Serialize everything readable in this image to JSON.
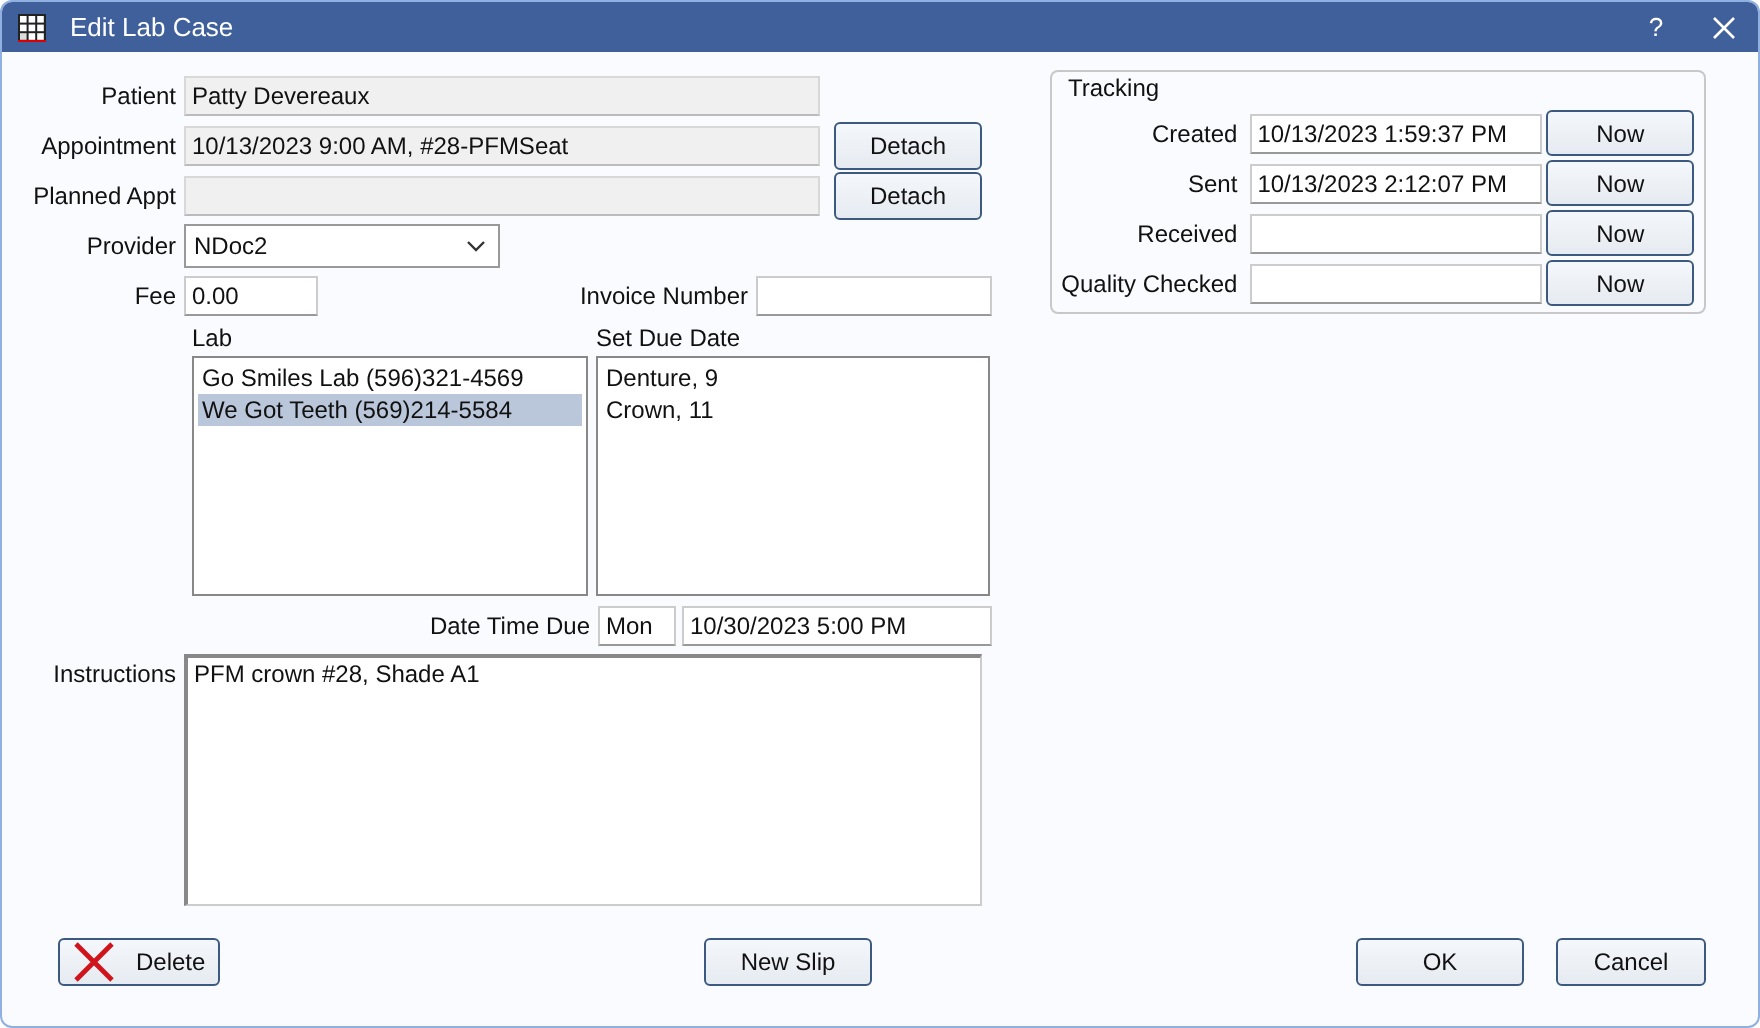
{
  "window": {
    "title": "Edit Lab Case",
    "help": "?"
  },
  "patient": {
    "label": "Patient",
    "value": "Patty Devereaux"
  },
  "appointment": {
    "label": "Appointment",
    "value": "10/13/2023 9:00 AM, #28-PFMSeat",
    "button": "Detach"
  },
  "planned_appt": {
    "label": "Planned Appt",
    "button": "Detach"
  },
  "provider": {
    "label": "Provider",
    "value": "NDoc2"
  },
  "fee": {
    "label": "Fee",
    "value": "0.00"
  },
  "invoice_number": {
    "label": "Invoice Number"
  },
  "lab": {
    "label": "Lab",
    "items": [
      {
        "text": "Go Smiles Lab (596)321-4569",
        "selected": false
      },
      {
        "text": "We Got Teeth (569)214-5584",
        "selected": true
      }
    ]
  },
  "set_due_date": {
    "label": "Set Due Date",
    "items": [
      {
        "text": "Denture, 9",
        "selected": false
      },
      {
        "text": "Crown, 11",
        "selected": false
      }
    ]
  },
  "date_time_due": {
    "label": "Date Time Due",
    "day": "Mon",
    "value": "10/30/2023 5:00 PM"
  },
  "instructions": {
    "label": "Instructions",
    "value": "PFM crown #28, Shade A1"
  },
  "tracking": {
    "title": "Tracking",
    "rows": [
      {
        "label": "Created",
        "value": "10/13/2023 1:59:37 PM",
        "button": "Now"
      },
      {
        "label": "Sent",
        "value": "10/13/2023 2:12:07 PM",
        "button": "Now"
      },
      {
        "label": "Received",
        "button": "Now"
      },
      {
        "label": "Quality Checked",
        "button": "Now"
      }
    ]
  },
  "buttons": {
    "delete": "Delete",
    "new_slip": "New Slip",
    "ok": "OK",
    "cancel": "Cancel"
  }
}
